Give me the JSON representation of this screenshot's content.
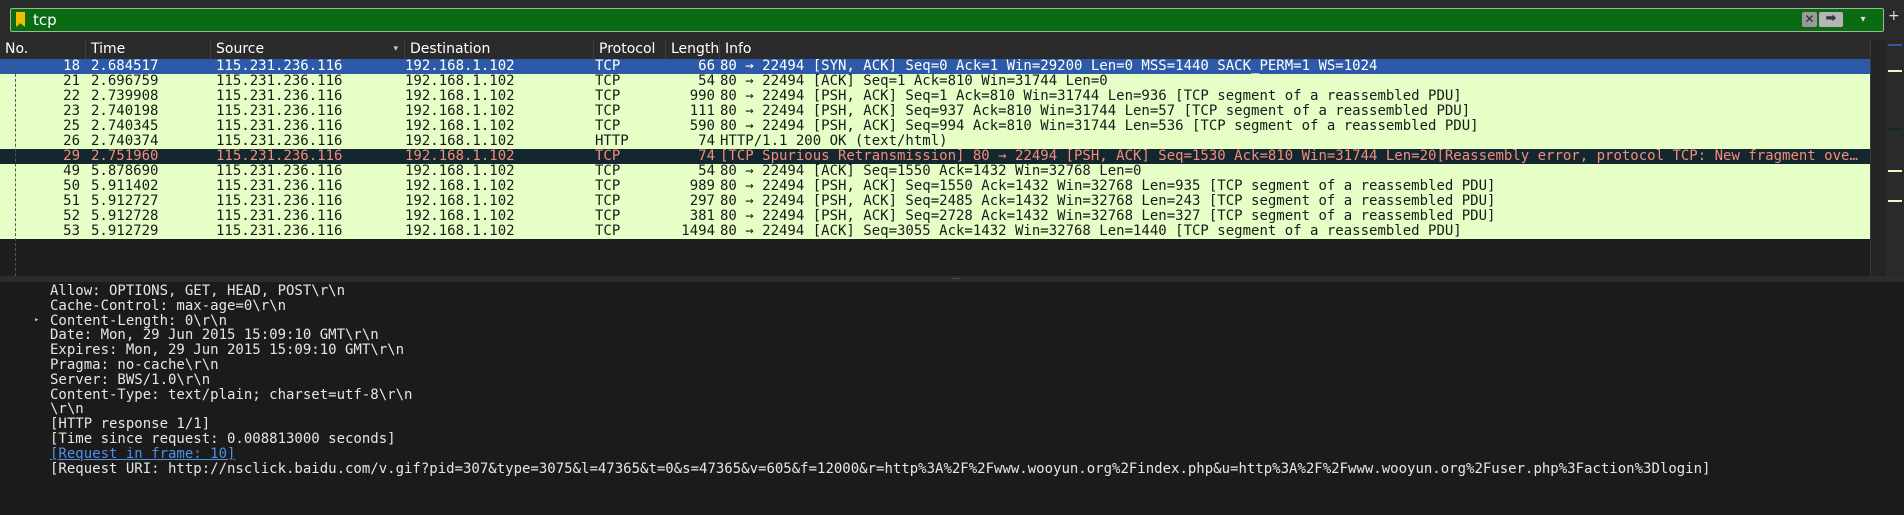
{
  "filter": {
    "text": "tcp",
    "clear_glyph": "✕",
    "apply_glyph": "➡",
    "dropdown_glyph": "▾",
    "plus_glyph": "+",
    "accent_color": "#0b6b12"
  },
  "columns": [
    "No.",
    "Time",
    "Source",
    "Destination",
    "Protocol",
    "Length",
    "Info"
  ],
  "sort_glyph": "▾",
  "packets": [
    {
      "no": "18",
      "time": "2.684517",
      "src": "115.231.236.116",
      "dst": "192.168.1.102",
      "proto": "TCP",
      "len": "66",
      "info": "80 → 22494 [SYN, ACK] Seq=0 Ack=1 Win=29200 Len=0 MSS=1440 SACK_PERM=1 WS=1024",
      "state": "selected"
    },
    {
      "no": "21",
      "time": "2.696759",
      "src": "115.231.236.116",
      "dst": "192.168.1.102",
      "proto": "TCP",
      "len": "54",
      "info": "80 → 22494 [ACK] Seq=1 Ack=810 Win=31744 Len=0",
      "state": "normal"
    },
    {
      "no": "22",
      "time": "2.739908",
      "src": "115.231.236.116",
      "dst": "192.168.1.102",
      "proto": "TCP",
      "len": "990",
      "info": "80 → 22494 [PSH, ACK] Seq=1 Ack=810 Win=31744 Len=936 [TCP segment of a reassembled PDU]",
      "state": "normal"
    },
    {
      "no": "23",
      "time": "2.740198",
      "src": "115.231.236.116",
      "dst": "192.168.1.102",
      "proto": "TCP",
      "len": "111",
      "info": "80 → 22494 [PSH, ACK] Seq=937 Ack=810 Win=31744 Len=57 [TCP segment of a reassembled PDU]",
      "state": "normal"
    },
    {
      "no": "25",
      "time": "2.740345",
      "src": "115.231.236.116",
      "dst": "192.168.1.102",
      "proto": "TCP",
      "len": "590",
      "info": "80 → 22494 [PSH, ACK] Seq=994 Ack=810 Win=31744 Len=536 [TCP segment of a reassembled PDU]",
      "state": "normal"
    },
    {
      "no": "26",
      "time": "2.740374",
      "src": "115.231.236.116",
      "dst": "192.168.1.102",
      "proto": "HTTP",
      "len": "74",
      "info": "HTTP/1.1 200 OK  (text/html)",
      "state": "normal"
    },
    {
      "no": "29",
      "time": "2.751960",
      "src": "115.231.236.116",
      "dst": "192.168.1.102",
      "proto": "TCP",
      "len": "74",
      "info": "[TCP Spurious Retransmission] 80 → 22494 [PSH, ACK] Seq=1530 Ack=810 Win=31744 Len=20[Reassembly error, protocol TCP: New fragment overlaps old data (retransmission?)]",
      "state": "bad"
    },
    {
      "no": "49",
      "time": "5.878690",
      "src": "115.231.236.116",
      "dst": "192.168.1.102",
      "proto": "TCP",
      "len": "54",
      "info": "80 → 22494 [ACK] Seq=1550 Ack=1432 Win=32768 Len=0",
      "state": "normal"
    },
    {
      "no": "50",
      "time": "5.911402",
      "src": "115.231.236.116",
      "dst": "192.168.1.102",
      "proto": "TCP",
      "len": "989",
      "info": "80 → 22494 [PSH, ACK] Seq=1550 Ack=1432 Win=32768 Len=935 [TCP segment of a reassembled PDU]",
      "state": "normal"
    },
    {
      "no": "51",
      "time": "5.912727",
      "src": "115.231.236.116",
      "dst": "192.168.1.102",
      "proto": "TCP",
      "len": "297",
      "info": "80 → 22494 [PSH, ACK] Seq=2485 Ack=1432 Win=32768 Len=243 [TCP segment of a reassembled PDU]",
      "state": "normal"
    },
    {
      "no": "52",
      "time": "5.912728",
      "src": "115.231.236.116",
      "dst": "192.168.1.102",
      "proto": "TCP",
      "len": "381",
      "info": "80 → 22494 [PSH, ACK] Seq=2728 Ack=1432 Win=32768 Len=327 [TCP segment of a reassembled PDU]",
      "state": "normal"
    },
    {
      "no": "53",
      "time": "5.912729",
      "src": "115.231.236.116",
      "dst": "192.168.1.102",
      "proto": "TCP",
      "len": "1494",
      "info": "80 → 22494 [ACK] Seq=3055 Ack=1432 Win=32768 Len=1440 [TCP segment of a reassembled PDU]",
      "state": "normal"
    }
  ],
  "row_colors": {
    "normal_bg": "#e6ffc7",
    "selected_bg": "#2c5aa8",
    "bad_bg": "#12272e",
    "bad_fg": "#f78b7a"
  },
  "details": [
    {
      "text": "Allow: OPTIONS, GET, HEAD, POST\\r\\n",
      "kind": "text"
    },
    {
      "text": "Cache-Control: max-age=0\\r\\n",
      "kind": "text"
    },
    {
      "text": "Content-Length: 0\\r\\n",
      "kind": "text",
      "expandable": true
    },
    {
      "text": "Date: Mon, 29 Jun 2015 15:09:10 GMT\\r\\n",
      "kind": "text"
    },
    {
      "text": "Expires: Mon, 29 Jun 2015 15:09:10 GMT\\r\\n",
      "kind": "text"
    },
    {
      "text": "Pragma: no-cache\\r\\n",
      "kind": "text"
    },
    {
      "text": "Server: BWS/1.0\\r\\n",
      "kind": "text"
    },
    {
      "text": "Content-Type: text/plain; charset=utf-8\\r\\n",
      "kind": "text"
    },
    {
      "text": "\\r\\n",
      "kind": "text"
    },
    {
      "text": "[HTTP response 1/1]",
      "kind": "text"
    },
    {
      "text": "[Time since request: 0.008813000 seconds]",
      "kind": "text"
    },
    {
      "text": "[Request in frame: 10]",
      "kind": "link"
    },
    {
      "text": "[Request URI: http://nsclick.baidu.com/v.gif?pid=307&type=3075&l=47365&t=0&s=47365&v=605&f=12000&r=http%3A%2F%2Fwww.wooyun.org%2Findex.php&u=http%3A%2F%2Fwww.wooyun.org%2Fuser.php%3Faction%3Dlogin]",
      "kind": "text"
    }
  ],
  "expander_glyph": "▸",
  "splitter_glyph": "⋯"
}
